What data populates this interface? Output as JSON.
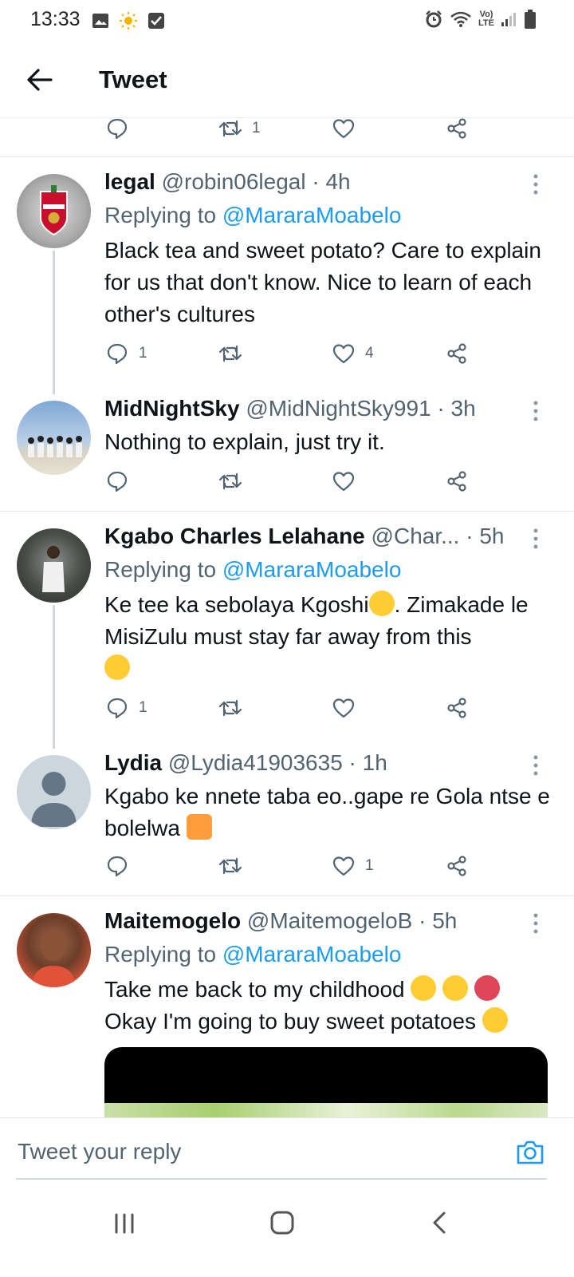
{
  "status_bar": {
    "time": "13:33",
    "left_icons": [
      "image-icon",
      "sun-icon",
      "checkbox-icon"
    ],
    "right_icons": [
      "alarm-icon",
      "wifi-icon",
      "volte-icon",
      "signal-icon",
      "battery-icon"
    ],
    "volte_label_top": "Vo)",
    "volte_label_bottom": "LTE"
  },
  "header": {
    "title": "Tweet"
  },
  "top_actions": {
    "retweets": "1"
  },
  "tweets": [
    {
      "name": "legal",
      "meta": "@robin06legal · 4h",
      "replying_prefix": "Replying to",
      "replying_to": "@MararaMoabelo",
      "text": "Black tea and sweet potato? Care to explain for us that don't know. Nice to learn  of each other's cultures",
      "reply_count": "1",
      "retweet_count": "",
      "like_count": "4"
    },
    {
      "name": "MidNightSky",
      "meta": "@MidNightSky991 · 3h",
      "text": "Nothing to explain, just try it.",
      "reply_count": "",
      "retweet_count": "",
      "like_count": ""
    },
    {
      "name": "Kgabo Charles Lelahane",
      "meta": "@Char... · 5h",
      "replying_prefix": "Replying to",
      "replying_to": "@MararaMoabelo",
      "text_part1": "Ke tee ka sebolaya Kgoshi",
      "text_part2": ". Zimakade le MisiZulu must stay far away from this",
      "reply_count": "1",
      "retweet_count": "",
      "like_count": ""
    },
    {
      "name": "Lydia",
      "meta": "@Lydia41903635 · 1h",
      "text": "Kgabo ke nnete taba eo..gape re Gola ntse e bolelwa",
      "reply_count": "",
      "retweet_count": "",
      "like_count": "1"
    },
    {
      "name": "Maitemogelo",
      "meta": "@MaitemogeloB · 5h",
      "replying_prefix": "Replying to",
      "replying_to": "@MararaMoabelo",
      "text_line1": "Take me back to my childhood",
      "text_line2": "Okay I'm going to buy sweet potatoes"
    }
  ],
  "reply_bar": {
    "placeholder": "Tweet your reply"
  },
  "colors": {
    "accent": "#1d9bf0",
    "secondary_text": "#536471",
    "primary_text": "#0f1419"
  }
}
